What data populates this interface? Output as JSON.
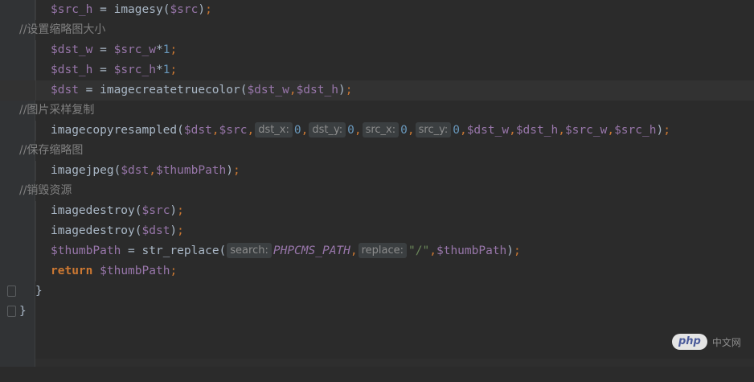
{
  "code": {
    "l1_var": "$src_h",
    "l1_eq": " = ",
    "l1_fn": "imagesy(",
    "l1_arg": "$src",
    "l1_close": ")",
    "l1_semi": ";",
    "l2_comment": "//设置缩略图大小",
    "l3_var": "$dst_w",
    "l3_eq": " = ",
    "l3_var2": "$src_w",
    "l3_op": "*",
    "l3_num": "1",
    "l3_semi": ";",
    "l4_var": "$dst_h",
    "l4_eq": " = ",
    "l4_var2": "$src_h",
    "l4_op": "*",
    "l4_num": "1",
    "l4_semi": ";",
    "l5_var": "$dst",
    "l5_eq": " = ",
    "l5_fn": "imagecreatetruecolor(",
    "l5_a1": "$dst_w",
    "l5_comma": ",",
    "l5_a2": "$dst_h",
    "l5_close": ")",
    "l5_semi": ";",
    "l6_comment": "//图片采样复制",
    "l7_fn": "imagecopyresampled(",
    "l7_a1": "$dst",
    "l7_a2": "$src",
    "l7_h1": "dst_x:",
    "l7_n1": "0",
    "l7_h2": "dst_y:",
    "l7_n2": "0",
    "l7_h3": "src_x:",
    "l7_n3": "0",
    "l7_h4": "src_y:",
    "l7_n4": "0",
    "l7_a3": "$dst_w",
    "l7_a4": "$dst_h",
    "l7_a5": "$src_w",
    "l7_a6": "$src_h",
    "l7_close": ")",
    "l7_semi": ";",
    "comma": ",",
    "l8_comment": "//保存缩略图",
    "l9_fn": "imagejpeg(",
    "l9_a1": "$dst",
    "l9_a2": "$thumbPath",
    "l9_close": ")",
    "l9_semi": ";",
    "l10_comment": "//销毁资源",
    "l11_fn": "imagedestroy(",
    "l11_a1": "$src",
    "l11_close": ")",
    "l11_semi": ";",
    "l12_fn": "imagedestroy(",
    "l12_a1": "$dst",
    "l12_close": ")",
    "l12_semi": ";",
    "l13_var": "$thumbPath",
    "l13_eq": " = ",
    "l13_fn": "str_replace(",
    "l13_h1": "search:",
    "l13_const": "PHPCMS_PATH",
    "l13_h2": "replace:",
    "l13_str": "\"/\"",
    "l13_a3": "$thumbPath",
    "l13_close": ")",
    "l13_semi": ";",
    "l14_kw": "return",
    "l14_var": "$thumbPath",
    "l14_semi": ";",
    "l15_brace": "}",
    "l16_brace": "}"
  },
  "watermark": {
    "logo": "php",
    "site": "中文网"
  },
  "colors": {
    "background": "#2b2b2b",
    "variable": "#9876aa",
    "keyword": "#cc7832",
    "number": "#6897bb",
    "string": "#6a8759",
    "comment": "#808080"
  },
  "icons": [
    "fold-marker-icon"
  ]
}
